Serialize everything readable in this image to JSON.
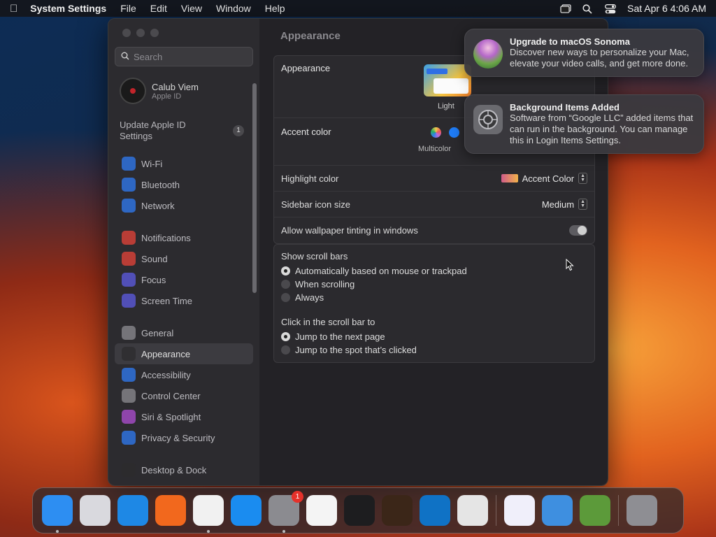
{
  "menubar": {
    "app_name": "System Settings",
    "items": [
      "File",
      "Edit",
      "View",
      "Window",
      "Help"
    ],
    "clock": "Sat Apr 6  4:06 AM"
  },
  "sidebar": {
    "search_placeholder": "Search",
    "profile": {
      "name": "Calub Viem",
      "subtitle": "Apple ID"
    },
    "update": {
      "label": "Update Apple ID Settings",
      "badge": "1"
    },
    "groups": [
      [
        {
          "label": "Wi-Fi",
          "icon": "wifi-icon",
          "color": "#2f7cf6"
        },
        {
          "label": "Bluetooth",
          "icon": "bluetooth-icon",
          "color": "#2f7cf6"
        },
        {
          "label": "Network",
          "icon": "globe-icon",
          "color": "#2f7cf6"
        }
      ],
      [
        {
          "label": "Notifications",
          "icon": "bell-icon",
          "color": "#e8443a"
        },
        {
          "label": "Sound",
          "icon": "speaker-icon",
          "color": "#e8443a"
        },
        {
          "label": "Focus",
          "icon": "moon-icon",
          "color": "#5e5ce6"
        },
        {
          "label": "Screen Time",
          "icon": "hourglass-icon",
          "color": "#5e5ce6"
        }
      ],
      [
        {
          "label": "General",
          "icon": "gear-icon",
          "color": "#8e8e93"
        },
        {
          "label": "Appearance",
          "icon": "appearance-icon",
          "color": "#2c2c2e",
          "active": true
        },
        {
          "label": "Accessibility",
          "icon": "accessibility-icon",
          "color": "#2f7cf6"
        },
        {
          "label": "Control Center",
          "icon": "control-center-icon",
          "color": "#8e8e93"
        },
        {
          "label": "Siri & Spotlight",
          "icon": "siri-icon",
          "color": "#b04fd6"
        },
        {
          "label": "Privacy & Security",
          "icon": "hand-icon",
          "color": "#2f7cf6"
        }
      ],
      [
        {
          "label": "Desktop & Dock",
          "icon": "dock-icon",
          "color": "#2c2c2e"
        }
      ]
    ]
  },
  "content": {
    "title": "Appearance",
    "appearance": {
      "label": "Appearance",
      "option_light": "Light"
    },
    "accent": {
      "label": "Accent color",
      "selected_name": "Multicolor"
    },
    "highlight": {
      "label": "Highlight color",
      "value": "Accent Color"
    },
    "sidebar_icon": {
      "label": "Sidebar icon size",
      "value": "Medium"
    },
    "tinting": {
      "label": "Allow wallpaper tinting in windows"
    },
    "scroll": {
      "label": "Show scroll bars",
      "options": [
        "Automatically based on mouse or trackpad",
        "When scrolling",
        "Always"
      ],
      "selected": 0
    },
    "click": {
      "label": "Click in the scroll bar to",
      "options": [
        "Jump to the next page",
        "Jump to the spot that’s clicked"
      ],
      "selected": 0
    },
    "help": "?"
  },
  "notifications": [
    {
      "title": "Upgrade to macOS Sonoma",
      "body": "Discover new ways to personalize your Mac, elevate your video calls, and get more done.",
      "icon": "macos-sonoma-icon"
    },
    {
      "title": "Background Items Added",
      "body": "Software from “Google LLC” added items that can run in the background. You can manage this in Login Items Settings.",
      "icon": "system-settings-icon"
    }
  ],
  "dock": {
    "apps": [
      {
        "name": "finder-icon",
        "color": "#2d8ef2",
        "running": true
      },
      {
        "name": "launchpad-icon",
        "color": "#d9d9de"
      },
      {
        "name": "safari-icon",
        "color": "#1e88e5"
      },
      {
        "name": "firefox-icon",
        "color": "#f2681d"
      },
      {
        "name": "chrome-icon",
        "color": "#f1f1f1",
        "running": true
      },
      {
        "name": "app-store-icon",
        "color": "#1a8cf0"
      },
      {
        "name": "system-settings-icon",
        "color": "#8b8b90",
        "running": true,
        "badge": "1"
      },
      {
        "name": "textedit-icon",
        "color": "#f4f4f4"
      },
      {
        "name": "terminal-icon",
        "color": "#1d1d1f"
      },
      {
        "name": "garageband-icon",
        "color": "#3b2618"
      },
      {
        "name": "vscode-icon",
        "color": "#0f72c5"
      },
      {
        "name": "roblox-icon",
        "color": "#e5e5e5"
      },
      {
        "sep": true
      },
      {
        "name": "visual-studio-icon",
        "color": "#f0effa"
      },
      {
        "name": "weather-icon",
        "color": "#3e8fe0"
      },
      {
        "name": "minecraft-icon",
        "color": "#5c9a3a"
      },
      {
        "sep": true
      },
      {
        "name": "trash-icon",
        "color": "#8e8e93"
      }
    ]
  }
}
